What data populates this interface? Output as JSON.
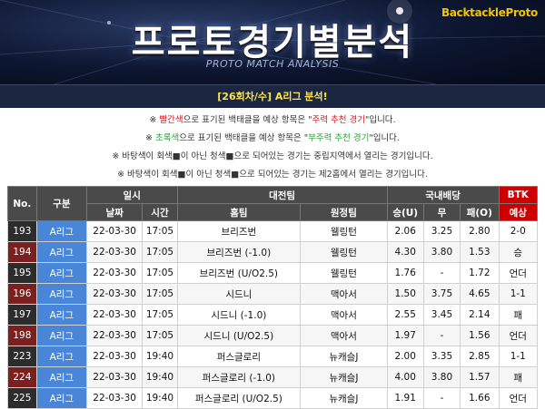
{
  "banner": {
    "brand": "BacktackleProto",
    "title": "프로토경기별분석",
    "subtitle": "PROTO MATCH ANALYSIS"
  },
  "round_label": "[26회차/수] A리그 분석!",
  "notes": [
    {
      "pre": "※ ",
      "a": "빨간색",
      "b": "으로 표기된 백태클을 예상 항목은 \"",
      "c": "주력 추천 경기",
      "d": "\"입니다."
    },
    {
      "pre": "※ ",
      "a": "초록색",
      "b": "으로 표기된 백태클을 예상 항목은 \"",
      "c": "부주력 추천 경기",
      "d": "\"입니다."
    },
    {
      "text": "※ 바탕색이 회색■이 아닌 청색■으로 되어있는 경기는 중립지역에서 열리는 경기입니다."
    },
    {
      "text": "※ 바탕색이 회색■이 아닌 청색■으로 되어있는 경기는 제2홈에서 열리는 경기입니다."
    }
  ],
  "table": {
    "headers": {
      "no": "No.",
      "kind": "구분",
      "datetime": "일시",
      "date": "날짜",
      "time": "시간",
      "match": "대전팀",
      "home": "홈팀",
      "away": "원정팀",
      "odds": "국내배당",
      "win": "승(U)",
      "draw": "무",
      "lose": "패(O)",
      "btk1": "BTK",
      "btk2": "예상"
    },
    "rows": [
      {
        "no": "193",
        "league": "A리그",
        "date": "22-03-30",
        "time": "17:05",
        "home": "브리즈번",
        "away": "웰링턴",
        "w": "2.06",
        "d": "3.25",
        "l": "2.80",
        "pick": "2-0",
        "pick_color": "red"
      },
      {
        "no": "194",
        "league": "A리그",
        "date": "22-03-30",
        "time": "17:05",
        "home": "브리즈번 (-1.0)",
        "away": "웰링턴",
        "w": "4.30",
        "d": "3.80",
        "l": "1.53",
        "pick": "승",
        "pick_color": "black"
      },
      {
        "no": "195",
        "league": "A리그",
        "date": "22-03-30",
        "time": "17:05",
        "home": "브리즈번 (U/O2.5)",
        "away": "웰링턴",
        "w": "1.76",
        "d": "-",
        "l": "1.72",
        "pick": "언더",
        "pick_color": "black"
      },
      {
        "no": "196",
        "league": "A리그",
        "date": "22-03-30",
        "time": "17:05",
        "home": "시드니",
        "away": "맥아서",
        "w": "1.50",
        "d": "3.75",
        "l": "4.65",
        "pick": "1-1",
        "pick_color": "black"
      },
      {
        "no": "197",
        "league": "A리그",
        "date": "22-03-30",
        "time": "17:05",
        "home": "시드니 (-1.0)",
        "away": "맥아서",
        "w": "2.55",
        "d": "3.45",
        "l": "2.14",
        "pick": "패",
        "pick_color": "green"
      },
      {
        "no": "198",
        "league": "A리그",
        "date": "22-03-30",
        "time": "17:05",
        "home": "시드니 (U/O2.5)",
        "away": "맥아서",
        "w": "1.97",
        "d": "-",
        "l": "1.56",
        "pick": "언더",
        "pick_color": "black"
      },
      {
        "no": "223",
        "league": "A리그",
        "date": "22-03-30",
        "time": "19:40",
        "home": "퍼스글로리",
        "away": "뉴캐슬J",
        "w": "2.00",
        "d": "3.35",
        "l": "2.85",
        "pick": "1-1",
        "pick_color": "black"
      },
      {
        "no": "224",
        "league": "A리그",
        "date": "22-03-30",
        "time": "19:40",
        "home": "퍼스글로리 (-1.0)",
        "away": "뉴캐슬J",
        "w": "4.00",
        "d": "3.80",
        "l": "1.57",
        "pick": "패",
        "pick_color": "red"
      },
      {
        "no": "225",
        "league": "A리그",
        "date": "22-03-30",
        "time": "19:40",
        "home": "퍼스글로리 (U/O2.5)",
        "away": "뉴캐슬J",
        "w": "1.91",
        "d": "-",
        "l": "1.66",
        "pick": "언더",
        "pick_color": "black"
      }
    ]
  }
}
